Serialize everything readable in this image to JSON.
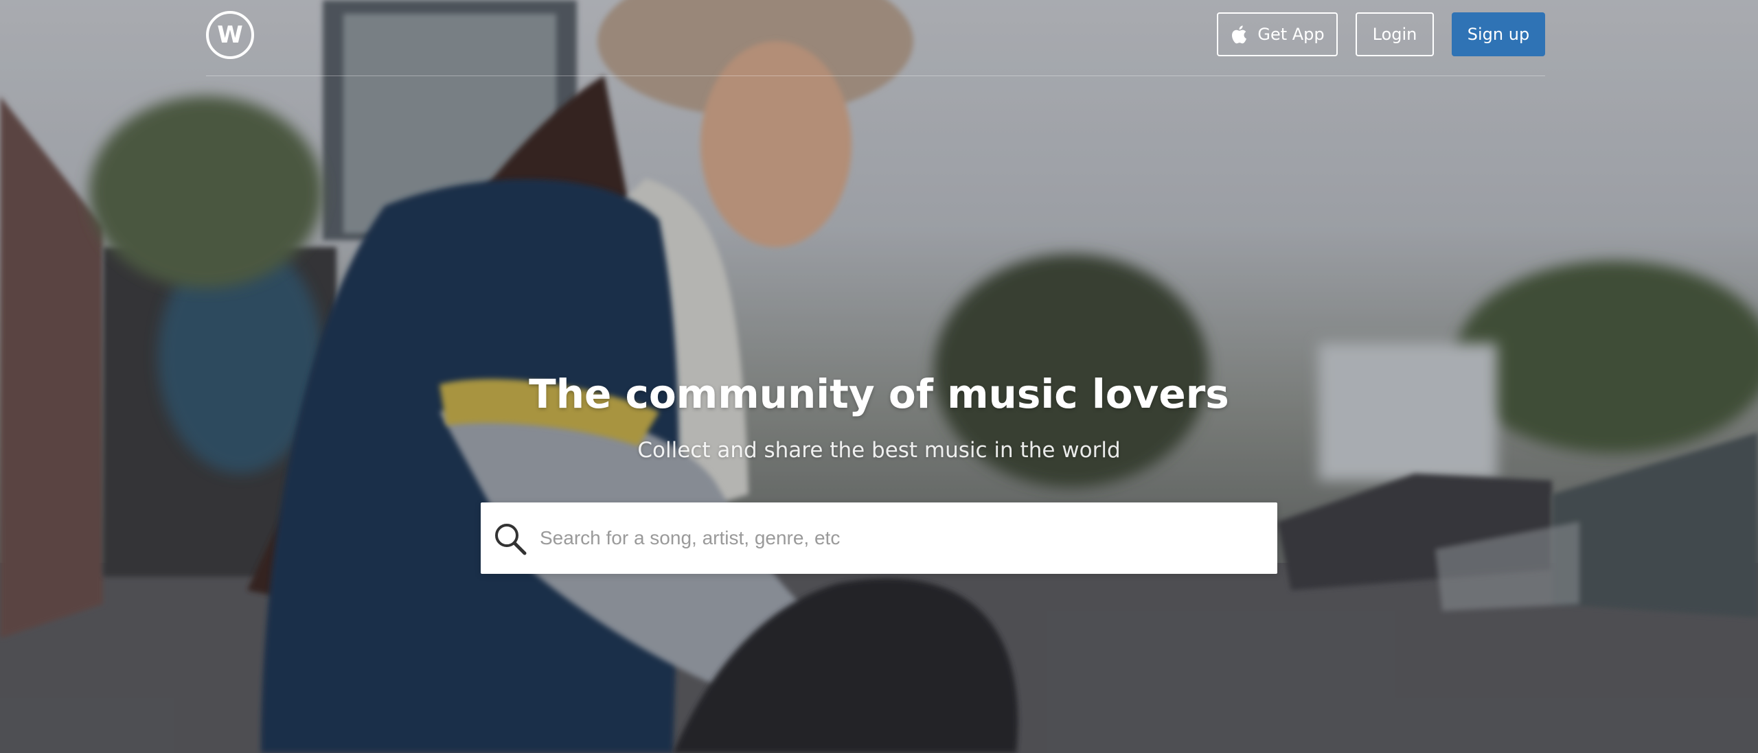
{
  "brand": {
    "logo_letter": "W"
  },
  "nav": {
    "get_app_label": "Get App",
    "login_label": "Login",
    "signup_label": "Sign up"
  },
  "hero": {
    "headline": "The community of music lovers",
    "subheadline": "Collect and share the best music in the world"
  },
  "search": {
    "placeholder": "Search for a song, artist, genre, etc",
    "value": ""
  },
  "colors": {
    "signup_button": "#2f73b5",
    "text_on_hero": "#ffffff"
  }
}
